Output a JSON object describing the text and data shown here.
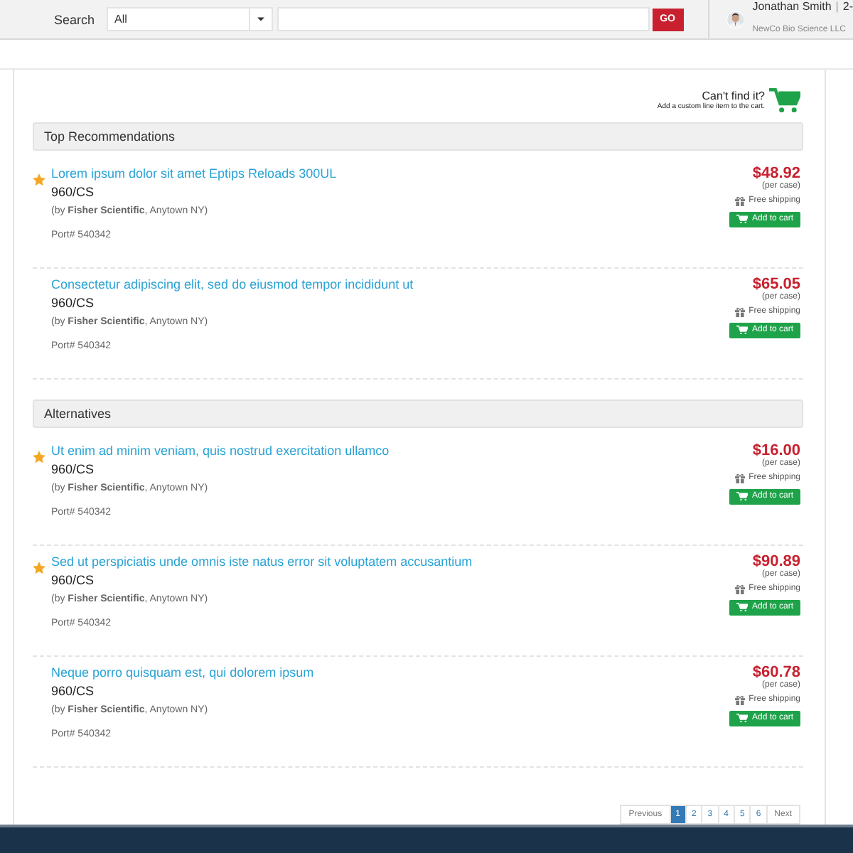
{
  "header": {
    "search_label": "Search",
    "category": {
      "value": "All"
    },
    "go_button": "GO",
    "user": {
      "name": "Jonathan Smith",
      "separator": "|",
      "extra": "2-",
      "company": "NewCo Bio Science LLC"
    }
  },
  "cant_find": {
    "title": "Can't find it?",
    "subtitle": "Add a custom line item to the cart."
  },
  "sections": [
    {
      "title": "Top Recommendations",
      "items": [
        {
          "starred": true,
          "title": "Lorem ipsum dolor sit amet Eptips Reloads 300UL",
          "size": "960/CS",
          "vendor": "(by **Fisher Scientific**, Anytown NY)",
          "port": "Port# 540342",
          "price": "$48.92",
          "unit": "(per case)",
          "shipping": "Free shipping",
          "button": "Add to cart"
        },
        {
          "starred": false,
          "title": "Consectetur adipiscing elit, sed do eiusmod tempor incididunt ut",
          "size": "960/CS",
          "vendor": "(by **Fisher Scientific**, Anytown NY)",
          "port": "Port# 540342",
          "price": "$65.05",
          "unit": "(per case)",
          "shipping": "Free shipping",
          "button": "Add to cart"
        }
      ]
    },
    {
      "title": "Alternatives",
      "items": [
        {
          "starred": true,
          "title": "Ut enim ad minim veniam, quis nostrud exercitation ullamco",
          "size": "960/CS",
          "vendor": "(by **Fisher Scientific**, Anytown NY)",
          "port": "Port# 540342",
          "price": "$16.00",
          "unit": "(per case)",
          "shipping": "Free shipping",
          "button": "Add to cart"
        },
        {
          "starred": true,
          "title": "Sed ut perspiciatis unde omnis iste natus error sit voluptatem accusantium",
          "size": "960/CS",
          "vendor": "(by **Fisher Scientific**, Anytown NY)",
          "port": "Port# 540342",
          "price": "$90.89",
          "unit": "(per case)",
          "shipping": "Free shipping",
          "button": "Add to cart"
        },
        {
          "starred": false,
          "title": "Neque porro quisquam est, qui dolorem ipsum",
          "size": "960/CS",
          "vendor": "(by **Fisher Scientific**, Anytown NY)",
          "port": "Port# 540342",
          "price": "$60.78",
          "unit": "(per case)",
          "shipping": "Free shipping",
          "button": "Add to cart"
        }
      ]
    }
  ],
  "pagination": [
    {
      "label": "Previous",
      "kind": "nav",
      "selected": false
    },
    {
      "label": "1",
      "kind": "page",
      "selected": true
    },
    {
      "label": "2",
      "kind": "page",
      "selected": false
    },
    {
      "label": "3",
      "kind": "page",
      "selected": false
    },
    {
      "label": "4",
      "kind": "page",
      "selected": false
    },
    {
      "label": "5",
      "kind": "page",
      "selected": false
    },
    {
      "label": "6",
      "kind": "page",
      "selected": false
    },
    {
      "label": "Next",
      "kind": "nav",
      "selected": false
    }
  ]
}
